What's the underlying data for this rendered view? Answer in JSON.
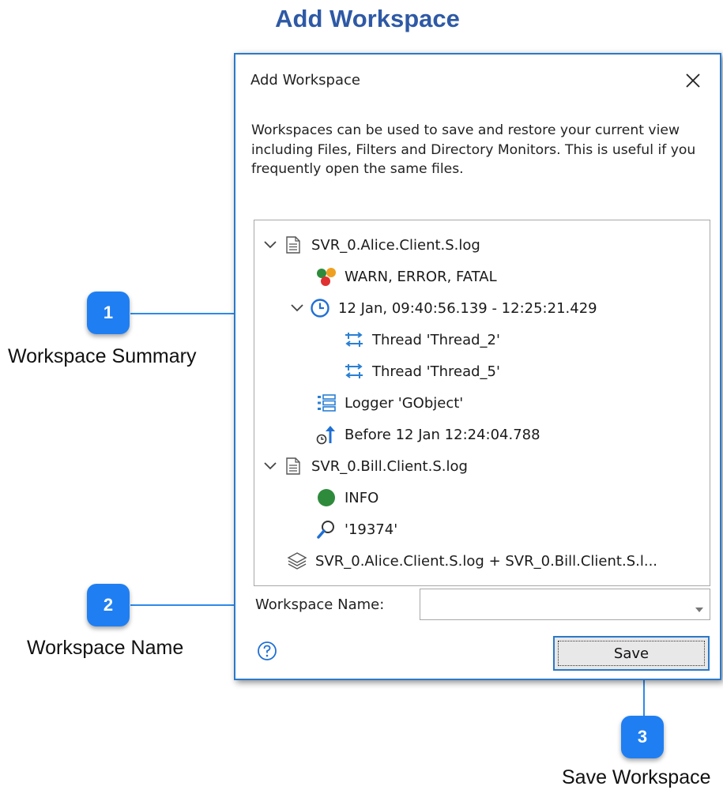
{
  "page": {
    "title": "Add Workspace"
  },
  "dialog": {
    "title": "Add Workspace",
    "description": "Workspaces can be used to save and restore your current view including Files, Filters and Directory Monitors.  This is useful if you frequently open the same files.",
    "tree": [
      {
        "label": "SVR_0.Alice.Client.S.log",
        "icon": "document-icon"
      },
      {
        "label": "WARN, ERROR, FATAL",
        "icon": "severity-dots-icon"
      },
      {
        "label": "12 Jan, 09:40:56.139 - 12:25:21.429",
        "icon": "clock-icon"
      },
      {
        "label": "Thread 'Thread_2'",
        "icon": "thread-icon"
      },
      {
        "label": "Thread 'Thread_5'",
        "icon": "thread-icon"
      },
      {
        "label": "Logger 'GObject'",
        "icon": "logger-icon"
      },
      {
        "label": "Before 12 Jan 12:24:04.788",
        "icon": "before-time-icon"
      },
      {
        "label": "SVR_0.Bill.Client.S.log",
        "icon": "document-icon"
      },
      {
        "label": "INFO",
        "icon": "green-dot-icon"
      },
      {
        "label": "'19374'",
        "icon": "search-icon"
      },
      {
        "label": "SVR_0.Alice.Client.S.log + SVR_0.Bill.Client.S.l...",
        "icon": "layers-icon"
      }
    ],
    "workspace_name_label": "Workspace Name:",
    "workspace_name_value": "",
    "save_label": "Save"
  },
  "callouts": [
    {
      "number": "1",
      "label": "Workspace Summary"
    },
    {
      "number": "2",
      "label": "Workspace Name"
    },
    {
      "number": "3",
      "label": "Save Workspace"
    }
  ],
  "colors": {
    "accent": "#2b79c9",
    "badge": "#1f7ff2",
    "title": "#2e59a5"
  }
}
